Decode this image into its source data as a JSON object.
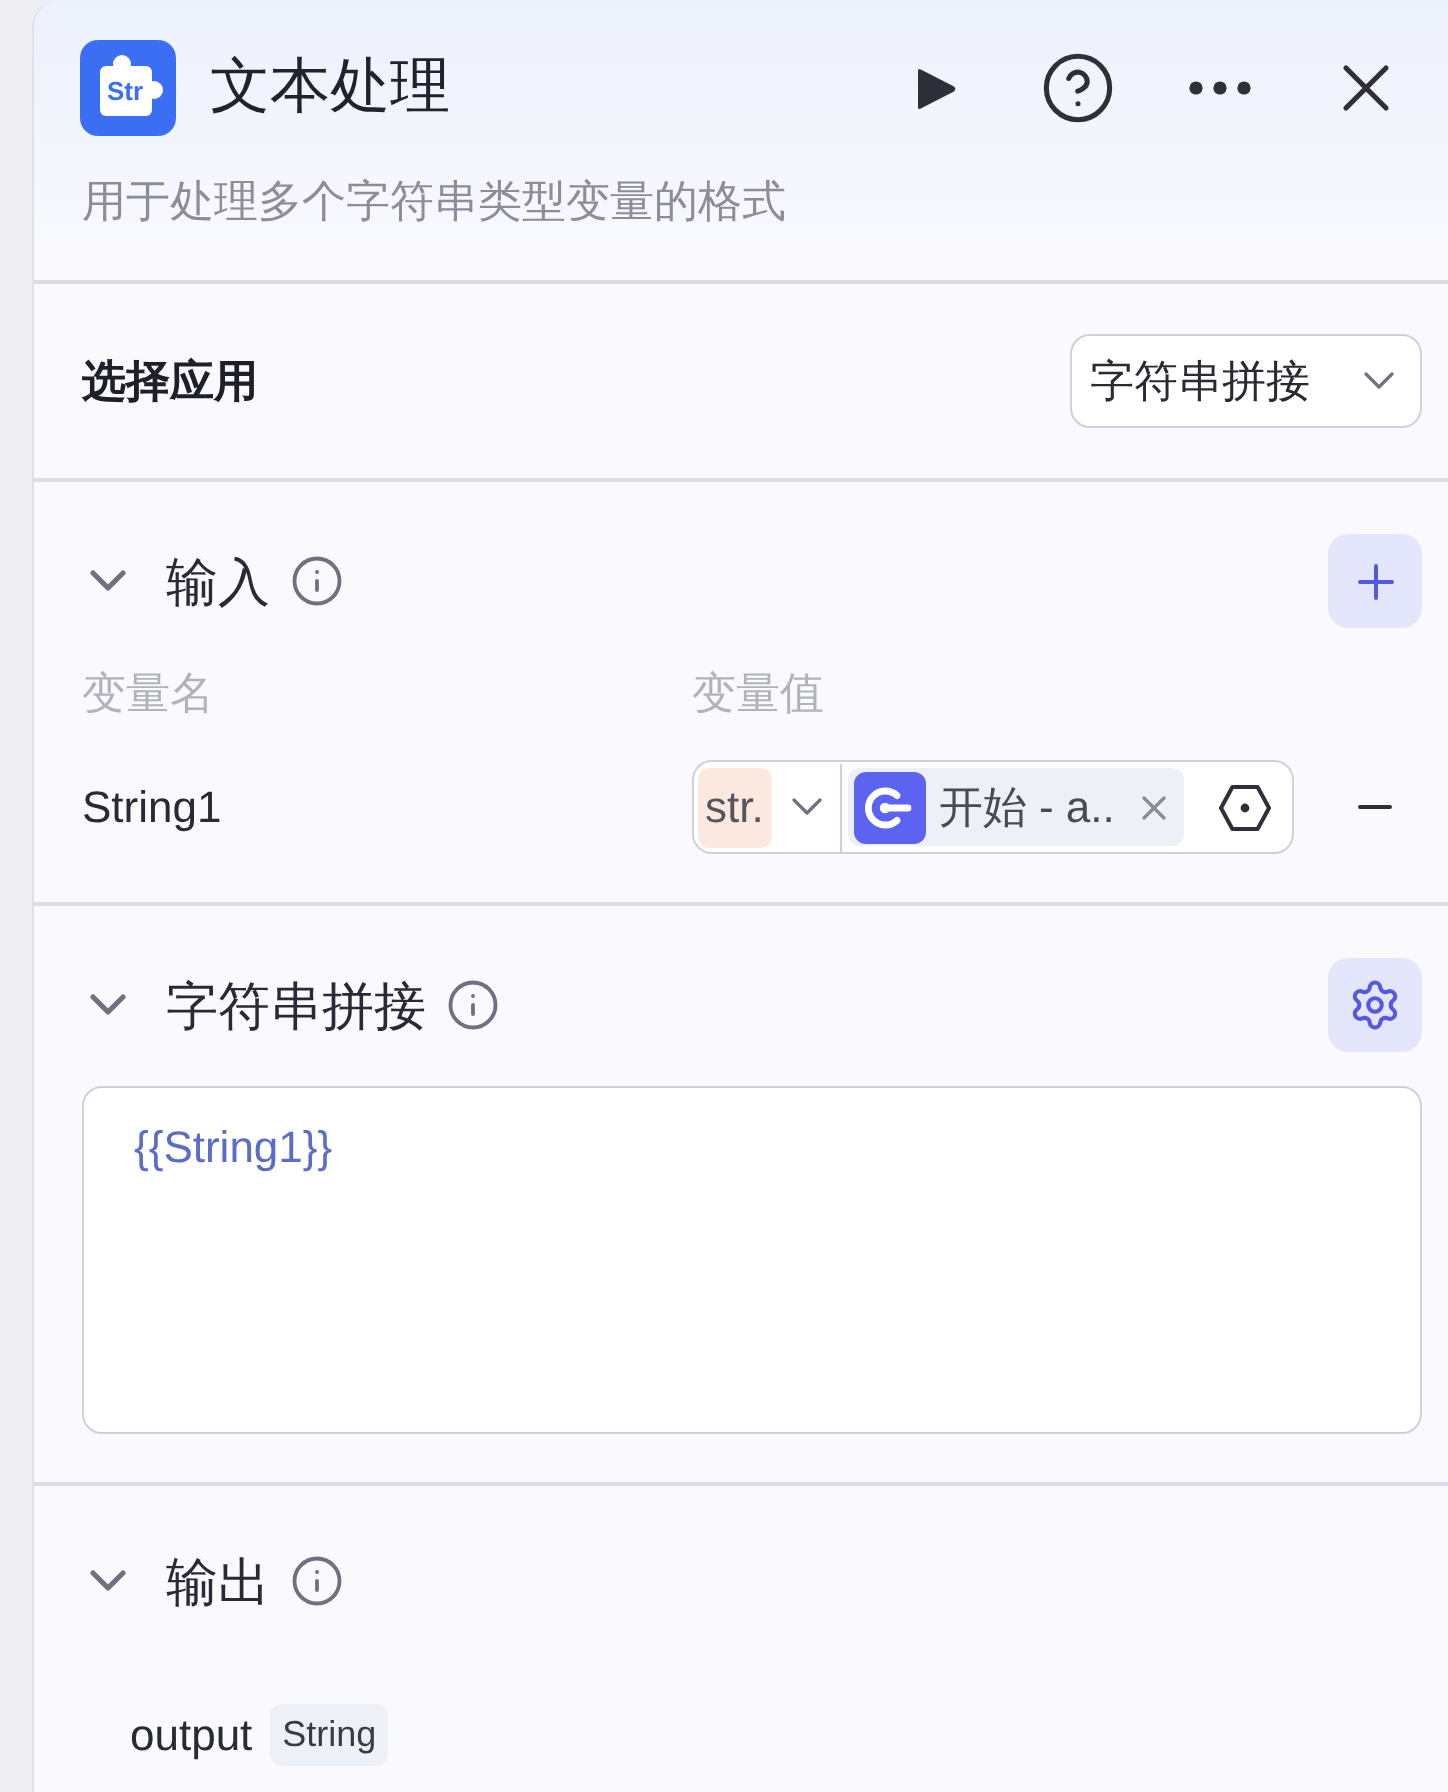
{
  "header": {
    "icon_text": "Str",
    "title": "文本处理",
    "description": "用于处理多个字符串类型变量的格式"
  },
  "app_select": {
    "label": "选择应用",
    "value": "字符串拼接"
  },
  "input": {
    "title": "输入",
    "expanded": true,
    "columns": [
      "变量名",
      "变量值"
    ],
    "rows": [
      {
        "name": "String1",
        "type": "str.",
        "reference": "开始 - a.."
      }
    ]
  },
  "concat": {
    "title": "字符串拼接",
    "expanded": true,
    "template": "{{String1}}"
  },
  "output": {
    "title": "输出",
    "expanded": true,
    "fields": [
      {
        "name": "output",
        "type": "String"
      }
    ]
  }
}
